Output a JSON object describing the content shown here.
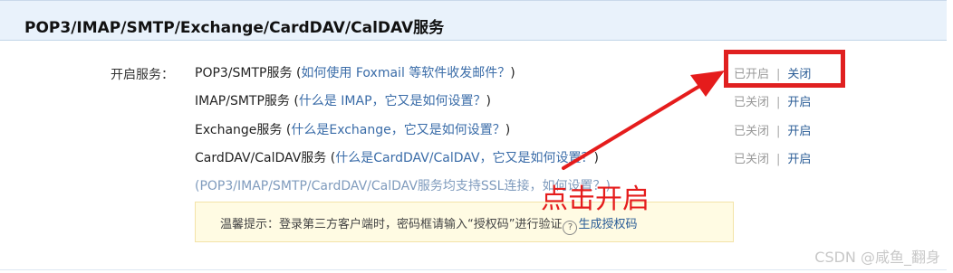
{
  "header": {
    "title": "POP3/IMAP/SMTP/Exchange/CardDAV/CalDAV服务"
  },
  "services_label": "开启服务：",
  "services": [
    {
      "name": "POP3/SMTP服务",
      "paren_open": "(",
      "help": "如何使用 Foxmail 等软件收发邮件？",
      "paren_close": ")",
      "state": "已开启",
      "separator": "|",
      "action": "关闭"
    },
    {
      "name": "IMAP/SMTP服务",
      "paren_open": "(",
      "help": "什么是 IMAP，它又是如何设置？",
      "paren_close": ")",
      "state": "已关闭",
      "separator": "|",
      "action": "开启"
    },
    {
      "name": "Exchange服务",
      "paren_open": "(",
      "help": "什么是Exchange，它又是如何设置？",
      "paren_close": ")",
      "state": "已关闭",
      "separator": "|",
      "action": "开启"
    },
    {
      "name": "CardDAV/CalDAV服务",
      "paren_open": "(",
      "help": "什么是CardDAV/CalDAV，它又是如何设置？",
      "paren_close": ")",
      "state": "已关闭",
      "separator": "|",
      "action": "开启"
    }
  ],
  "ssl_note": "(POP3/IMAP/SMTP/CardDAV/CalDAV服务均支持SSL连接，如何设置？)",
  "tip": {
    "text": "温馨提示：登录第三方客户端时，密码框请输入“授权码”进行验证",
    "question_icon": "?",
    "link": "生成授权码"
  },
  "annotation": {
    "text": "点击开启",
    "color": "#e51c1c"
  },
  "watermark": "CSDN @咸鱼_翻身"
}
